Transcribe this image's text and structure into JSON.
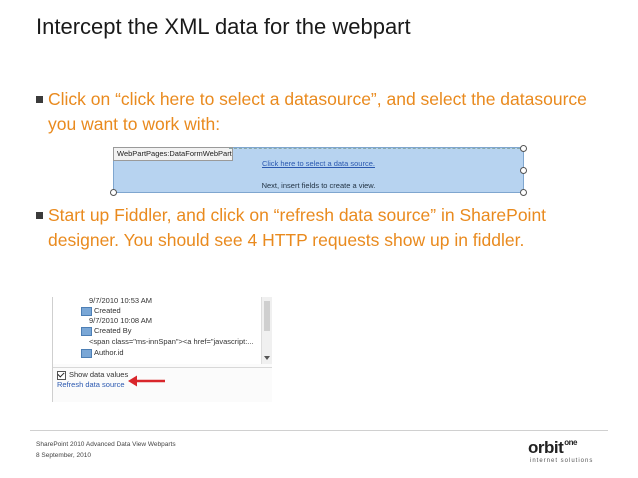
{
  "slide": {
    "title": "Intercept the XML data for the webpart",
    "bullet1": "Click on “click here to select a datasource”, and select the datasource you want to work with:",
    "bullet2": "Start up Fiddler, and click on “refresh data source” in SharePoint designer. You should see 4 HTTP requests show up in fiddler."
  },
  "webpart": {
    "tab_label": "WebPartPages:DataFormWebPart",
    "select_link": "Click here to select a data source.",
    "hint": "Next, insert fields to create a view."
  },
  "panel": {
    "rows": [
      "9/7/2010 10:53 AM",
      "Created",
      "9/7/2010 10:08 AM",
      "Created By",
      "<span class=\"ms-innSpan\"><a href=\"javascript:...",
      "Author.id"
    ],
    "show_values": "Show data values",
    "refresh_link": "Refresh data source"
  },
  "footer": {
    "line1": "SharePoint 2010 Advanced Data View Webparts",
    "line2": "8 September, 2010"
  },
  "logo": {
    "word": "orbit",
    "word_suffix": "one",
    "tagline": "internet solutions"
  },
  "colors": {
    "accent": "#e98a1e",
    "link": "#2a58b0",
    "arrow": "#d9262b"
  }
}
